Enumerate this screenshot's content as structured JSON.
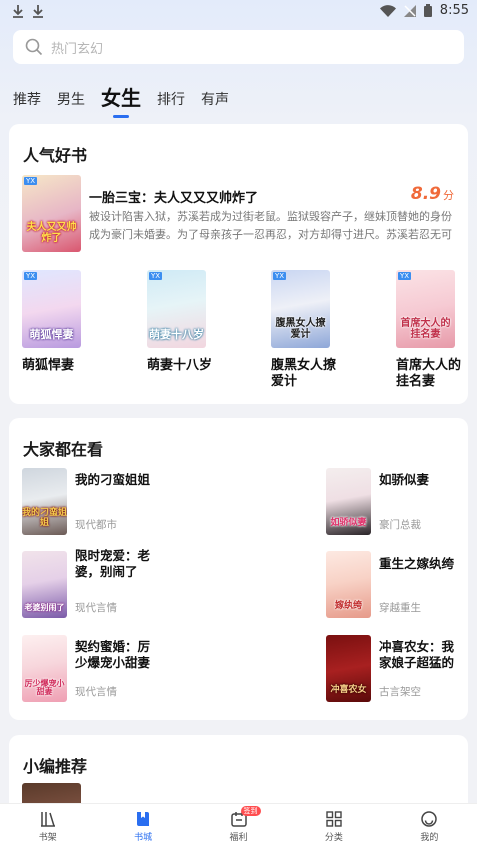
{
  "status_bar": {
    "time": "8:55"
  },
  "search": {
    "placeholder": "热门玄幻"
  },
  "tabs": [
    {
      "label": "推荐",
      "active": false
    },
    {
      "label": "男生",
      "active": false
    },
    {
      "label": "女生",
      "active": true
    },
    {
      "label": "排行",
      "active": false
    },
    {
      "label": "有声",
      "active": false
    }
  ],
  "popular": {
    "title": "人气好书",
    "featured": {
      "title": "一胎三宝：夫人又又又帅炸了",
      "score": "8.9",
      "score_unit": "分",
      "desc": "被设计陷害入狱，苏溪若成为过街老鼠。监狱毁容产子，继妹顶替她的身份成为豪门未婚妻。为了母亲孩子一忍再忍，对方却得寸进尺。苏溪若忍无可忍...",
      "cover_text": "夫人又又帅炸了"
    },
    "grid": [
      {
        "title": "萌狐悍妻",
        "cover_text": "萌狐悍妻"
      },
      {
        "title": "萌妻十八岁",
        "cover_text": "萌妻十八岁"
      },
      {
        "title": "腹黑女人撩爱计",
        "cover_text": "腹黑女人撩爱计"
      },
      {
        "title": "首席大人的挂名妻",
        "cover_text": "首席大人的挂名妻"
      }
    ]
  },
  "everyone": {
    "title": "大家都在看",
    "items": [
      {
        "title": "我的刁蛮姐姐",
        "genre": "现代都市",
        "cover_text": "我的刁蛮姐姐"
      },
      {
        "title": "如骄似妻",
        "genre": "豪门总裁",
        "cover_text": "如骄似妻"
      },
      {
        "title": "限时宠爱：老婆，别闹了",
        "genre": "现代言情",
        "cover_text": "老婆别闹了"
      },
      {
        "title": "重生之嫁纨绔",
        "genre": "穿越重生",
        "cover_text": "嫁纨绔"
      },
      {
        "title": "契约蜜婚：厉少爆宠小甜妻",
        "genre": "现代言情",
        "cover_text": "厉少爆宠小甜妻"
      },
      {
        "title": "冲喜农女：我家娘子超猛的",
        "genre": "古言架空",
        "cover_text": "冲喜农女"
      }
    ]
  },
  "editor": {
    "title": "小编推荐"
  },
  "bottom_nav": [
    {
      "label": "书架",
      "icon": "bookshelf-icon"
    },
    {
      "label": "书城",
      "icon": "bookstore-icon",
      "active": true
    },
    {
      "label": "福利",
      "icon": "gift-calendar-icon",
      "badge": "签到"
    },
    {
      "label": "分类",
      "icon": "category-grid-icon"
    },
    {
      "label": "我的",
      "icon": "profile-icon"
    }
  ],
  "colors": {
    "accent": "#2a6ef0",
    "score": "#f06a3a"
  }
}
